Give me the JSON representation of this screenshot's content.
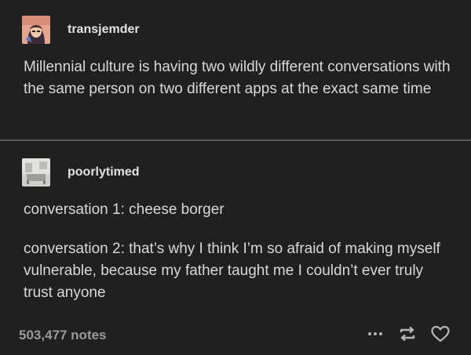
{
  "post1": {
    "username": "transjemder",
    "avatar_icon": "illustrated-avatar-icon",
    "text": "Millennial culture is having two wildly different conversations with the same person on two different apps at the exact same time"
  },
  "post2": {
    "username": "poorlytimed",
    "avatar_icon": "room-photo-avatar-icon",
    "paragraph1": "conversation 1: cheese borger",
    "paragraph2": "conversation 2: that’s why I think I’m so afraid of making myself vulnerable, because my father taught me I couldn’t ever truly trust anyone"
  },
  "footer": {
    "notes": "503,477 notes",
    "icons": [
      "more-options-icon",
      "reblog-icon",
      "like-heart-icon"
    ]
  },
  "colors": {
    "background": "#202020",
    "text": "#d8d8d8",
    "muted": "#9a9a9a",
    "divider": "#5a5a5a"
  }
}
